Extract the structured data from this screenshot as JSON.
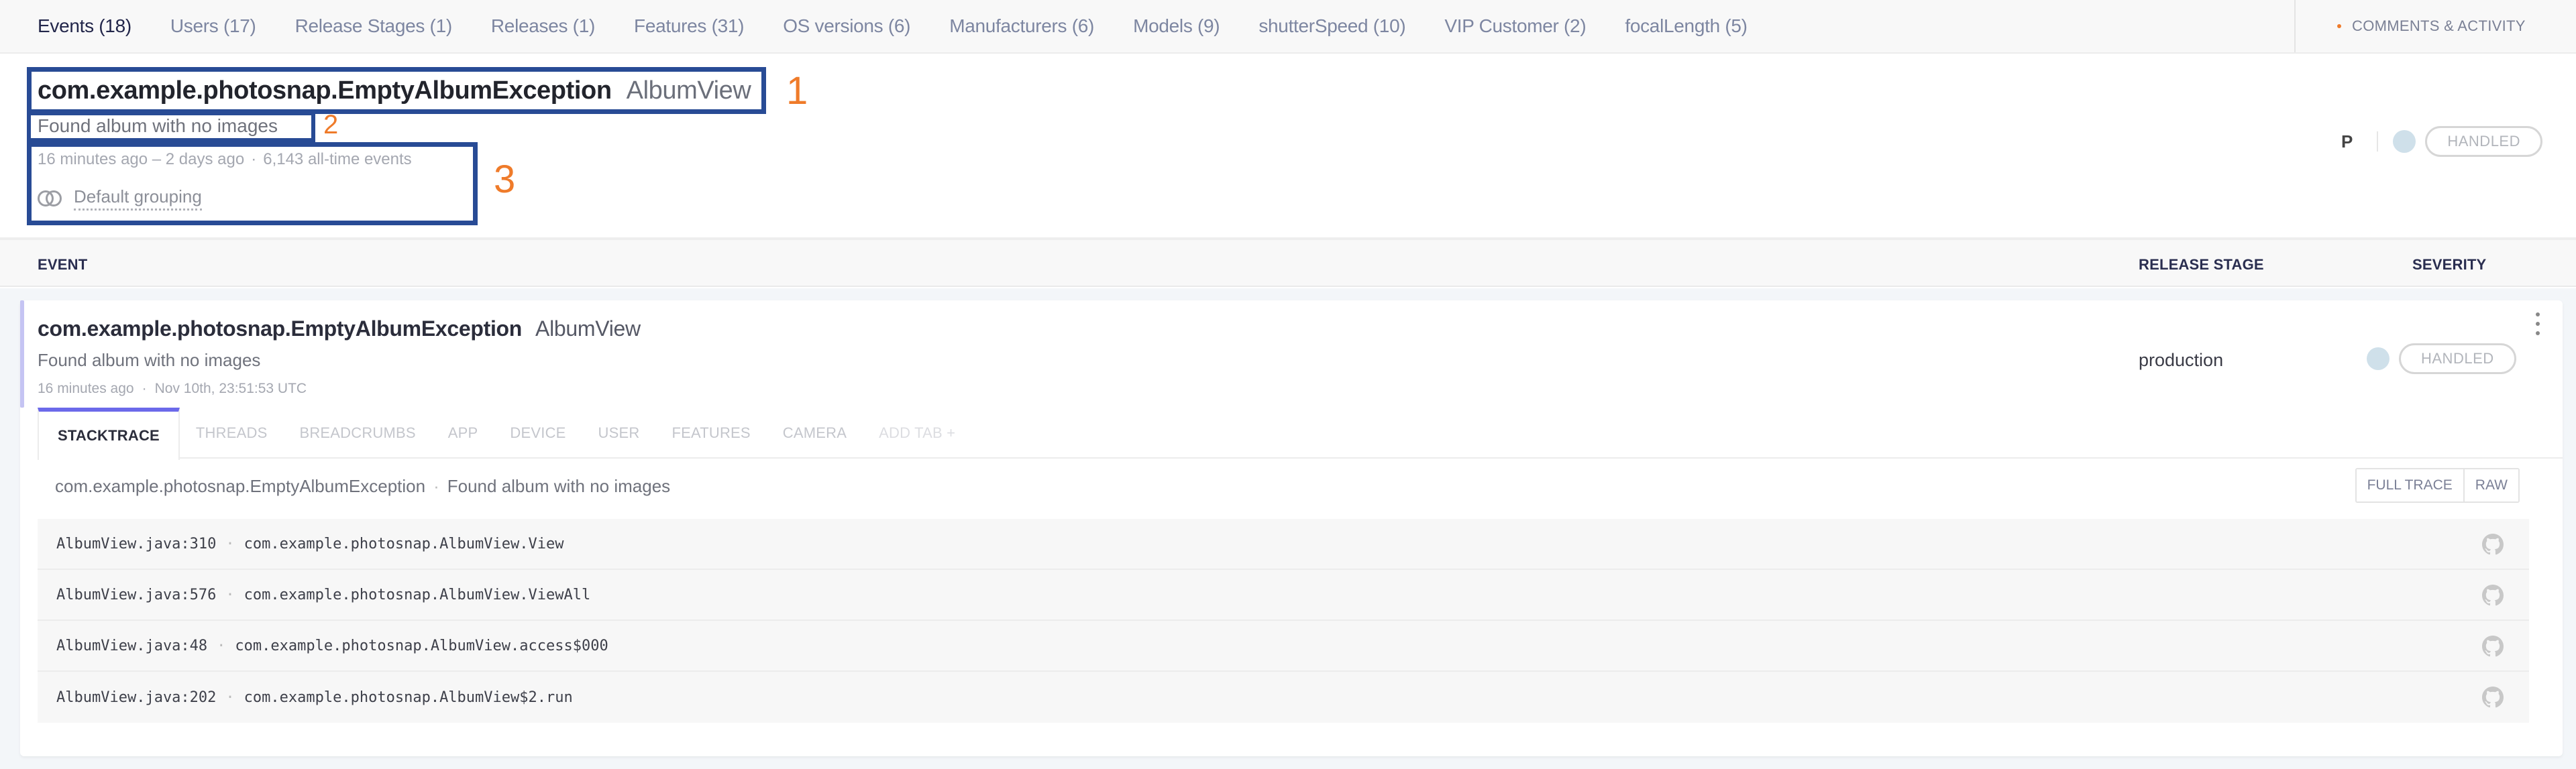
{
  "top_tabs": [
    {
      "label": "Events (18)",
      "active": true
    },
    {
      "label": "Users (17)",
      "active": false
    },
    {
      "label": "Release Stages (1)",
      "active": false
    },
    {
      "label": "Releases (1)",
      "active": false
    },
    {
      "label": "Features (31)",
      "active": false
    },
    {
      "label": "OS versions (6)",
      "active": false
    },
    {
      "label": "Manufacturers (6)",
      "active": false
    },
    {
      "label": "Models (9)",
      "active": false
    },
    {
      "label": "shutterSpeed (10)",
      "active": false
    },
    {
      "label": "VIP Customer (2)",
      "active": false
    },
    {
      "label": "focalLength (5)",
      "active": false
    }
  ],
  "comments_label": "Comments & Activity",
  "error": {
    "class_name": "com.example.photosnap.EmptyAlbumException",
    "context": "AlbumView",
    "message": "Found album with no images",
    "time_range": "16 minutes ago – 2 days ago",
    "separator": "·",
    "event_count": "6,143 all-time events",
    "grouping": "Default grouping",
    "priority_label": "P",
    "handled_label": "HANDLED"
  },
  "annotations": [
    "1",
    "2",
    "3"
  ],
  "annotation_colors": {
    "box": "#284b95",
    "number": "#ef7b2a"
  },
  "table_header": {
    "event": "Event",
    "release_stage": "Release Stage",
    "severity": "Severity"
  },
  "event": {
    "class_name": "com.example.photosnap.EmptyAlbumException",
    "context": "AlbumView",
    "message": "Found album with no images",
    "relative_time": "16 minutes ago",
    "separator": "·",
    "timestamp": "Nov 10th, 23:51:53 UTC",
    "release_stage": "production",
    "handled_label": "HANDLED"
  },
  "detail_tabs": [
    {
      "label": "Stacktrace",
      "active": true
    },
    {
      "label": "Threads",
      "active": false
    },
    {
      "label": "Breadcrumbs",
      "active": false
    },
    {
      "label": "App",
      "active": false
    },
    {
      "label": "Device",
      "active": false
    },
    {
      "label": "User",
      "active": false
    },
    {
      "label": "Features",
      "active": false
    },
    {
      "label": "Camera",
      "active": false
    },
    {
      "label": "Add tab +",
      "active": false
    }
  ],
  "stacktrace": {
    "exception": "com.example.photosnap.EmptyAlbumException",
    "message": "Found album with no images",
    "full_trace_label": "Full trace",
    "raw_label": "Raw",
    "frames": [
      {
        "file": "AlbumView.java:310",
        "method": "com.example.photosnap.AlbumView.View",
        "icon": "github-icon"
      },
      {
        "file": "AlbumView.java:576",
        "method": "com.example.photosnap.AlbumView.ViewAll",
        "icon": "github-icon"
      },
      {
        "file": "AlbumView.java:48",
        "method": "com.example.photosnap.AlbumView.access$000",
        "icon": "github-icon"
      },
      {
        "file": "AlbumView.java:202",
        "method": "com.example.photosnap.AlbumView$2.run",
        "icon": "github-icon"
      }
    ]
  },
  "colors": {
    "accent": "#6b69ea",
    "severity_dot": "#cfe0ea",
    "comments_dot": "#ef7b2a"
  }
}
